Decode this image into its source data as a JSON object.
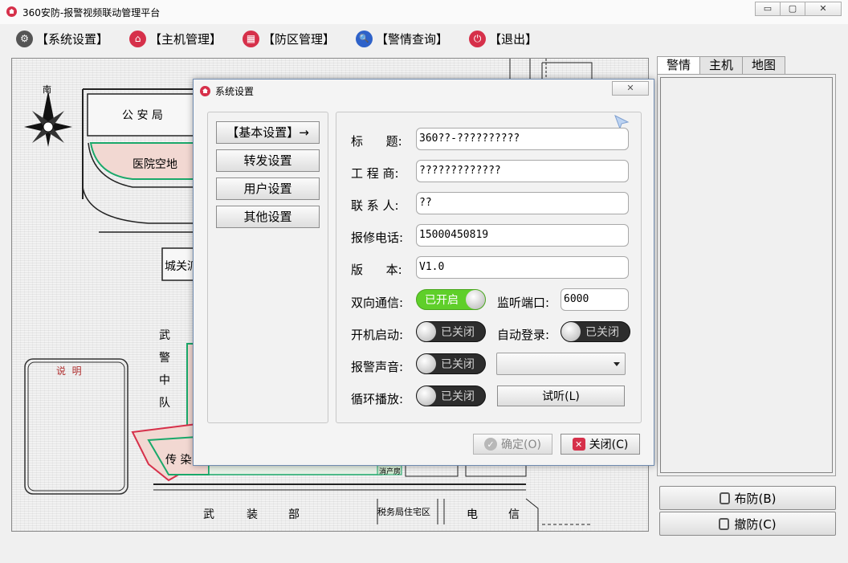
{
  "window": {
    "title": "360安防-报警视频联动管理平台",
    "min_glyph": "▭",
    "max_glyph": "▢",
    "close_glyph": "✕"
  },
  "menu": [
    {
      "id": "settings",
      "label": "【系统设置】",
      "icon": "gear-icon",
      "color": "#444444",
      "glyph": "⚙"
    },
    {
      "id": "host",
      "label": "【主机管理】",
      "icon": "home-icon",
      "color": "#d6304a",
      "glyph": "⌂"
    },
    {
      "id": "zone",
      "label": "【防区管理】",
      "icon": "grid-icon",
      "color": "#d6304a",
      "glyph": "▦"
    },
    {
      "id": "alarm",
      "label": "【警情查询】",
      "icon": "search-icon",
      "color": "#2e62c9",
      "glyph": "🔍"
    },
    {
      "id": "exit",
      "label": "【退出】",
      "icon": "power-icon",
      "color": "#d6304a",
      "glyph": "⏻"
    }
  ],
  "map": {
    "compass_label": "南",
    "police": "公 安 局",
    "hospital": "医院空地",
    "chengguan": "城关派",
    "wujing": [
      "武",
      "警",
      "中",
      "队"
    ],
    "legend": "说  明",
    "infectious": "传 染",
    "small_label": "消产房",
    "wuzhuang": [
      "武",
      "装",
      "部"
    ],
    "tax": "税务局住宅区",
    "telecom": [
      "电",
      "信"
    ]
  },
  "right_panel": {
    "tabs": [
      "警情",
      "主机",
      "地图"
    ],
    "arm_label": "布防(B)",
    "disarm_label": "撤防(C)"
  },
  "dialog": {
    "title": "系统设置",
    "close_glyph": "✕",
    "nav": [
      "【基本设置】→",
      "转发设置",
      "用户设置",
      "其他设置"
    ],
    "fields": {
      "title_label": "标      题:",
      "title_value": "360??-??????????",
      "vendor_label": "工 程 商:",
      "vendor_value": "?????????????",
      "contact_label": "联 系 人:",
      "contact_value": "??",
      "phone_label": "报修电话:",
      "phone_value": "15000450819",
      "version_label": "版      本:",
      "version_value": "V1.0"
    },
    "toggles": {
      "duplex_label": "双向通信:",
      "duplex_state": "已开启",
      "listen_port_label": "监听端口:",
      "listen_port_value": "6000",
      "autostart_label": "开机启动:",
      "autostart_state": "已关闭",
      "autologin_label": "自动登录:",
      "autologin_state": "已关闭",
      "sound_label": "报警声音:",
      "sound_state": "已关闭",
      "loop_label": "循环播放:",
      "loop_state": "已关闭"
    },
    "test_label": "试听(L)",
    "confirm_label": "确定(O)",
    "close_label": "关闭(C)",
    "accent_on": "#5fcf2a",
    "accent_close": "#d6304a"
  }
}
